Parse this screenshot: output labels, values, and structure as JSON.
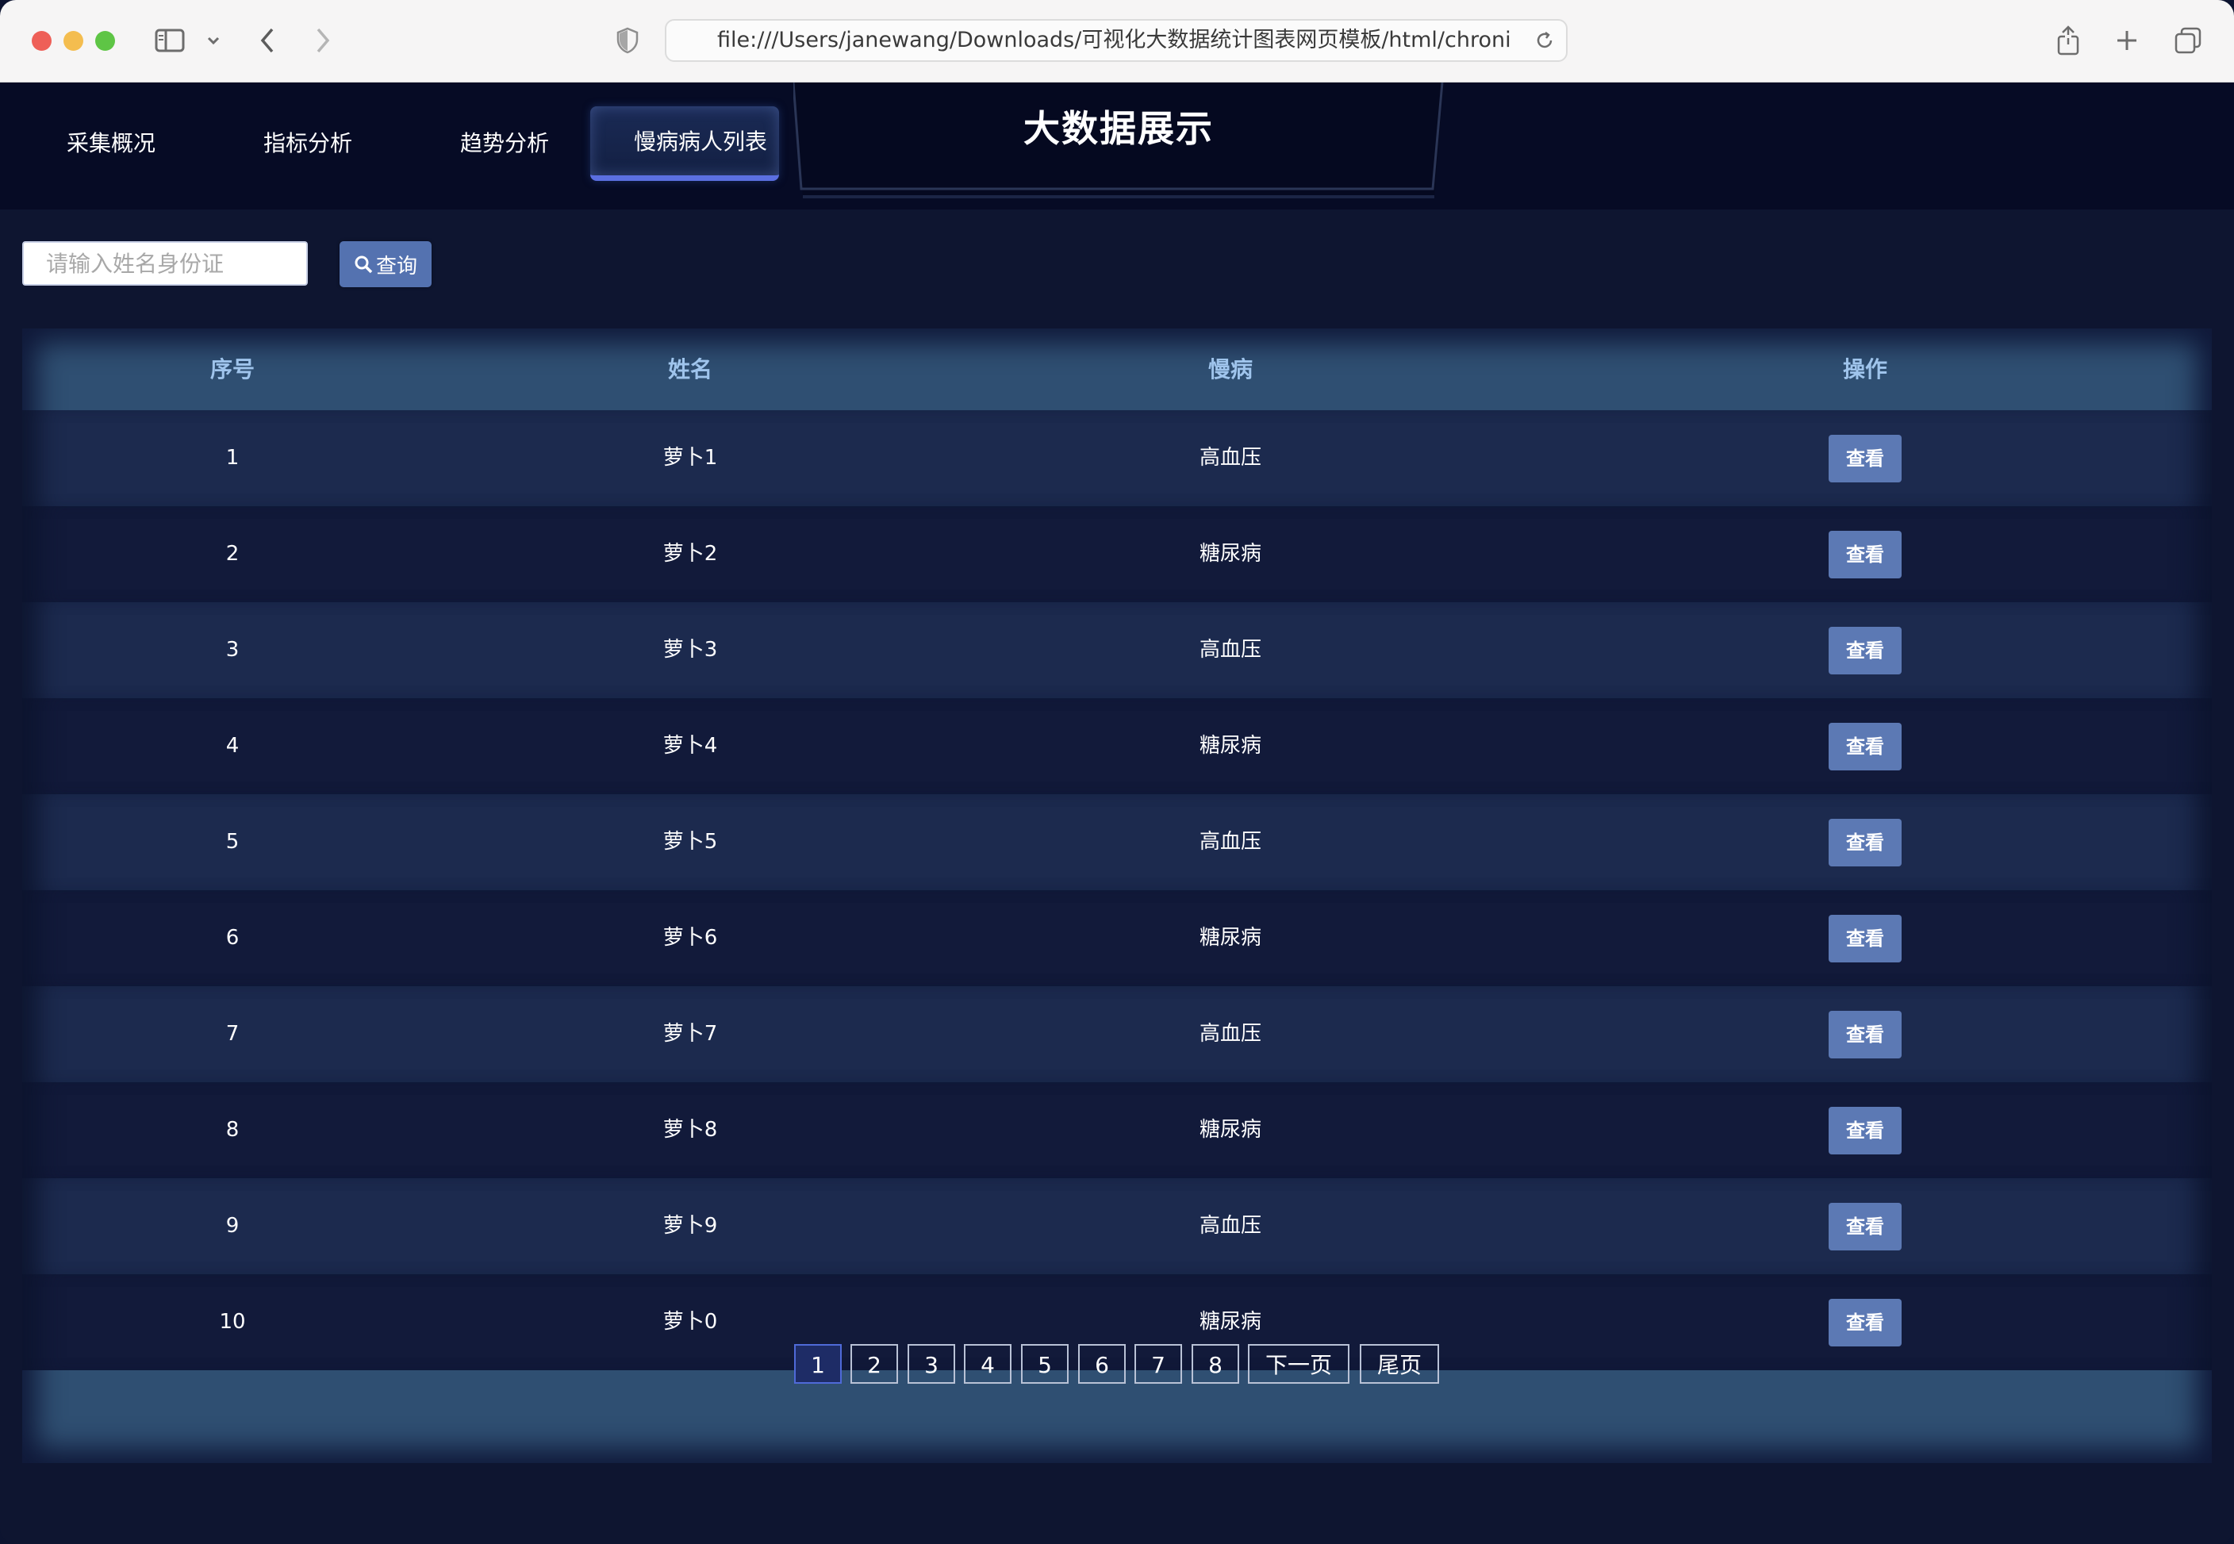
{
  "browser": {
    "url": "file:///Users/janewang/Downloads/可视化大数据统计图表网页模板/html/chronic.html"
  },
  "header": {
    "title": "大数据展示",
    "tabs": [
      {
        "label": "采集概况"
      },
      {
        "label": "指标分析"
      },
      {
        "label": "趋势分析"
      },
      {
        "label": "慢病病人列表",
        "active": true
      }
    ]
  },
  "search": {
    "placeholder": "请输入姓名身份证",
    "button_label": "查询",
    "icon": "search-icon"
  },
  "table": {
    "columns": [
      "序号",
      "姓名",
      "慢病",
      "操作"
    ],
    "rows": [
      {
        "index": "1",
        "name": "萝卜1",
        "disease": "高血压",
        "action": "查看"
      },
      {
        "index": "2",
        "name": "萝卜2",
        "disease": "糖尿病",
        "action": "查看"
      },
      {
        "index": "3",
        "name": "萝卜3",
        "disease": "高血压",
        "action": "查看"
      },
      {
        "index": "4",
        "name": "萝卜4",
        "disease": "糖尿病",
        "action": "查看"
      },
      {
        "index": "5",
        "name": "萝卜5",
        "disease": "高血压",
        "action": "查看"
      },
      {
        "index": "6",
        "name": "萝卜6",
        "disease": "糖尿病",
        "action": "查看"
      },
      {
        "index": "7",
        "name": "萝卜7",
        "disease": "高血压",
        "action": "查看"
      },
      {
        "index": "8",
        "name": "萝卜8",
        "disease": "糖尿病",
        "action": "查看"
      },
      {
        "index": "9",
        "name": "萝卜9",
        "disease": "高血压",
        "action": "查看"
      },
      {
        "index": "10",
        "name": "萝卜0",
        "disease": "糖尿病",
        "action": "查看"
      }
    ]
  },
  "pagination": {
    "pages": [
      "1",
      "2",
      "3",
      "4",
      "5",
      "6",
      "7",
      "8"
    ],
    "current": "1",
    "next_label": "下一页",
    "last_label": "尾页"
  },
  "colors": {
    "background": "#0e1530",
    "header_bg": "#060b25",
    "accent": "#5b6fe0",
    "button": "#5c79b4",
    "header_text": "#9fc4ec"
  }
}
